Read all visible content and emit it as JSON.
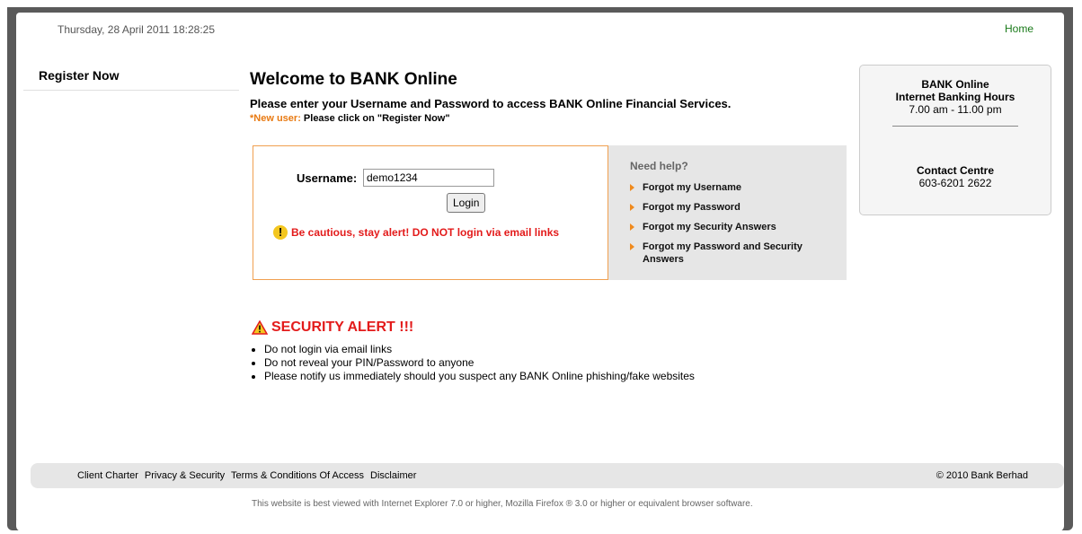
{
  "header": {
    "datetime": "Thursday, 28 April 2011 18:28:25",
    "home_link": "Home"
  },
  "sidebar": {
    "items": [
      {
        "label": "Register Now"
      }
    ]
  },
  "welcome": {
    "title": "Welcome to BANK Online",
    "subtitle": "Please enter your Username and Password to access BANK Online Financial Services.",
    "new_user_label": "*New user:",
    "new_user_text": "Please click on \"Register Now\""
  },
  "login": {
    "username_label": "Username:",
    "username_value": "demo1234",
    "button_label": "Login",
    "caution_icon": "!",
    "caution_text": "Be cautious, stay alert! DO NOT login via email links"
  },
  "help": {
    "title": "Need help?",
    "items": [
      {
        "label": "Forgot my Username"
      },
      {
        "label": "Forgot my Password"
      },
      {
        "label": "Forgot my Security Answers"
      },
      {
        "label": "Forgot my Password and Security Answers"
      }
    ]
  },
  "info": {
    "hours_title_1": "BANK Online",
    "hours_title_2": "Internet Banking Hours",
    "hours_value": "7.00 am - 11.00 pm",
    "contact_title": "Contact Centre",
    "contact_value": "603-6201 2622"
  },
  "security": {
    "title": "SECURITY ALERT !!!",
    "items": [
      "Do not login via email links",
      "Do not reveal your PIN/Password to anyone",
      "Please notify us immediately should you suspect any BANK Online phishing/fake websites"
    ]
  },
  "footer": {
    "links": [
      {
        "label": "Client Charter"
      },
      {
        "label": "Privacy & Security"
      },
      {
        "label": "Terms & Conditions Of Access"
      },
      {
        "label": "Disclaimer"
      }
    ],
    "copyright": "© 2010 Bank Berhad",
    "browser_note": "This website is best viewed with Internet Explorer 7.0 or higher, Mozilla Firefox ® 3.0 or higher or equivalent browser software."
  },
  "colors": {
    "frame": "#5a5a5a",
    "alert_red": "#e31b1b",
    "accent_orange": "#f08a1c",
    "home_green": "#1a7a1a",
    "panel_gray": "#e6e6e6"
  }
}
